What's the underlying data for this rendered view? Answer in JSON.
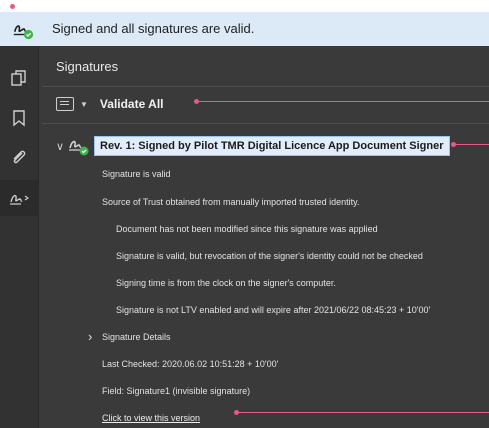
{
  "banner": {
    "text": "Signed and all signatures are valid."
  },
  "panel": {
    "title": "Signatures",
    "validate_all": "Validate All",
    "revision_label": "Rev. 1:  Signed by Pilot TMR Digital Licence App Document Signer",
    "lines": [
      "Signature is valid",
      "Source of Trust obtained from manually imported trusted identity.",
      "Document has not been modified since this signature was applied",
      "Signature is valid, but revocation of the signer's identity could not be checked",
      "Signing time is from the clock on the signer's computer.",
      "Signature is not LTV enabled and will expire after 2021/06/22 08:45:23 + 10'00'"
    ],
    "signature_details": "Signature Details",
    "last_checked": "Last Checked: 2020.06.02 10:51:28 + 10'00'",
    "field": "Field: Signature1 (invisible signature)",
    "view_version_link": "Click to view this version"
  },
  "rail": {
    "icons": [
      "copy-pages-icon",
      "bookmark-icon",
      "attachment-icon",
      "signature-icon"
    ]
  },
  "colors": {
    "banner_bg": "#dce9f7",
    "panel_bg": "#3a3a3a",
    "annotation": "#e65b86",
    "valid_green": "#3fb34f"
  }
}
